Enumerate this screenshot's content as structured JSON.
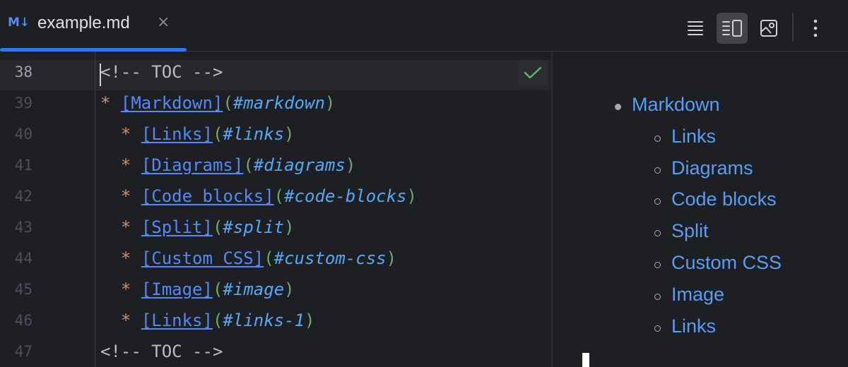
{
  "tab": {
    "icon_text": "M↓",
    "title": "example.md",
    "close_glyph": "×"
  },
  "toolbar": {
    "buttons": [
      {
        "name": "editor-only",
        "icon": "lines-icon",
        "active": false
      },
      {
        "name": "editor-and-preview",
        "icon": "split-view-icon",
        "active": true
      },
      {
        "name": "preview-only",
        "icon": "image-preview-icon",
        "active": false
      },
      {
        "name": "more",
        "icon": "more-vertical-icon",
        "active": false
      }
    ]
  },
  "editor": {
    "current_line": "38",
    "line_numbers": [
      "38",
      "39",
      "40",
      "41",
      "42",
      "43",
      "44",
      "45",
      "46",
      "47"
    ],
    "lines": [
      {
        "type": "comment",
        "text": "<!-- TOC -->"
      },
      {
        "type": "item",
        "indent": "",
        "label": "Markdown",
        "anchor": "#markdown"
      },
      {
        "type": "item",
        "indent": "  ",
        "label": "Links",
        "anchor": "#links"
      },
      {
        "type": "item",
        "indent": "  ",
        "label": "Diagrams",
        "anchor": "#diagrams"
      },
      {
        "type": "item",
        "indent": "  ",
        "label": "Code blocks",
        "anchor": "#code-blocks"
      },
      {
        "type": "item",
        "indent": "  ",
        "label": "Split",
        "anchor": "#split"
      },
      {
        "type": "item",
        "indent": "  ",
        "label": "Custom CSS",
        "anchor": "#custom-css"
      },
      {
        "type": "item",
        "indent": "  ",
        "label": "Image",
        "anchor": "#image"
      },
      {
        "type": "item",
        "indent": "  ",
        "label": "Links",
        "anchor": "#links-1"
      },
      {
        "type": "comment",
        "text": "<!-- TOC -->"
      }
    ],
    "status_icon": "checkmark-icon"
  },
  "preview": {
    "items": [
      {
        "label": "Markdown",
        "level": 1
      },
      {
        "label": "Links",
        "level": 2
      },
      {
        "label": "Diagrams",
        "level": 2
      },
      {
        "label": "Code blocks",
        "level": 2
      },
      {
        "label": "Split",
        "level": 2
      },
      {
        "label": "Custom CSS",
        "level": 2
      },
      {
        "label": "Image",
        "level": 2
      },
      {
        "label": "Links",
        "level": 2
      }
    ]
  },
  "colors": {
    "accent": "#3574f0",
    "link": "#548af7",
    "bullet": "#cf8e6d",
    "paren": "#6aab73",
    "check": "#5fb865"
  }
}
